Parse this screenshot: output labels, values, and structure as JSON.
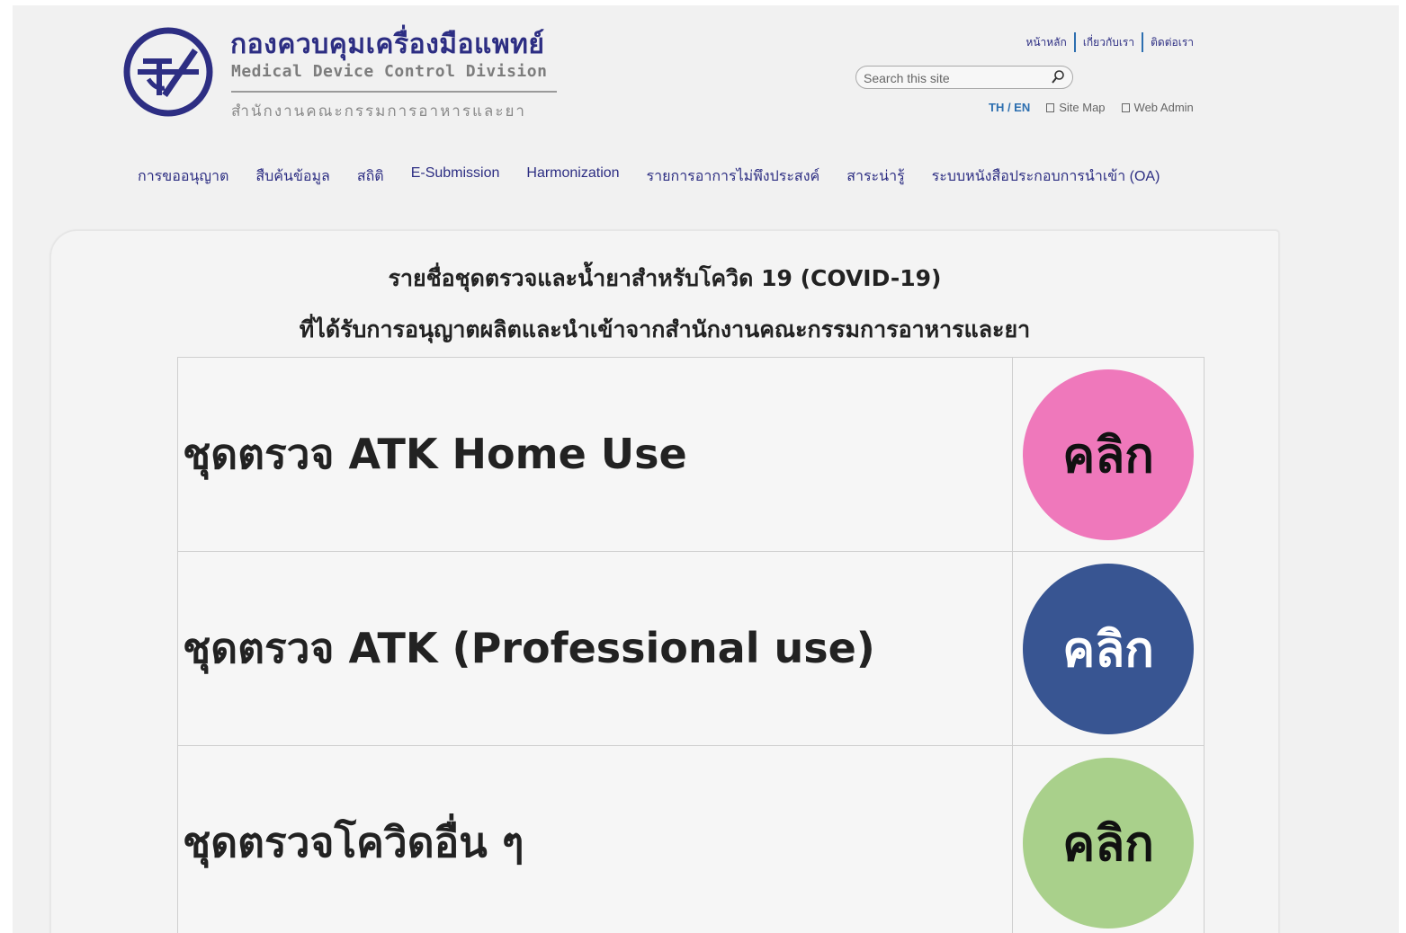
{
  "header": {
    "title_th": "กองควบคุมเครื่องมือแพทย์",
    "title_en": "Medical Device Control Division",
    "subtitle_th": "สำนักงานคณะกรรมการอาหารและยา",
    "top_links": [
      "หน้าหลัก",
      "เกี่ยวกับเรา",
      "ติดต่อเรา"
    ],
    "search_placeholder": "Search this site",
    "lang": "TH / EN",
    "site_map": "Site Map",
    "web_admin": "Web Admin",
    "brand_color": "#2d2e83"
  },
  "nav": {
    "items": [
      "การขออนุญาต",
      "สืบค้นข้อมูล",
      "สถิติ",
      "E-Submission",
      "Harmonization",
      "รายการอาการไม่พึงประสงค์",
      "สาระน่ารู้",
      "ระบบหนังสือประกอบการนำเข้า (OA)"
    ]
  },
  "content": {
    "heading_line1": "รายชื่อชุดตรวจและน้ำยาสำหรับโควิด 19 (COVID-19)",
    "heading_line2": "ที่ได้รับการอนุญาตผลิตและนำเข้าจากสำนักงานคณะกรรมการอาหารและยา",
    "items": [
      {
        "label": "ชุดตรวจ ATK Home Use",
        "button": "คลิก",
        "button_color": "#ef78bb"
      },
      {
        "label": "ชุดตรวจ ATK (Professional use)",
        "button": "คลิก",
        "button_color": "#385592"
      },
      {
        "label": "ชุดตรวจโควิดอื่น ๆ",
        "button": "คลิก",
        "button_color": "#a9d08b"
      }
    ]
  }
}
